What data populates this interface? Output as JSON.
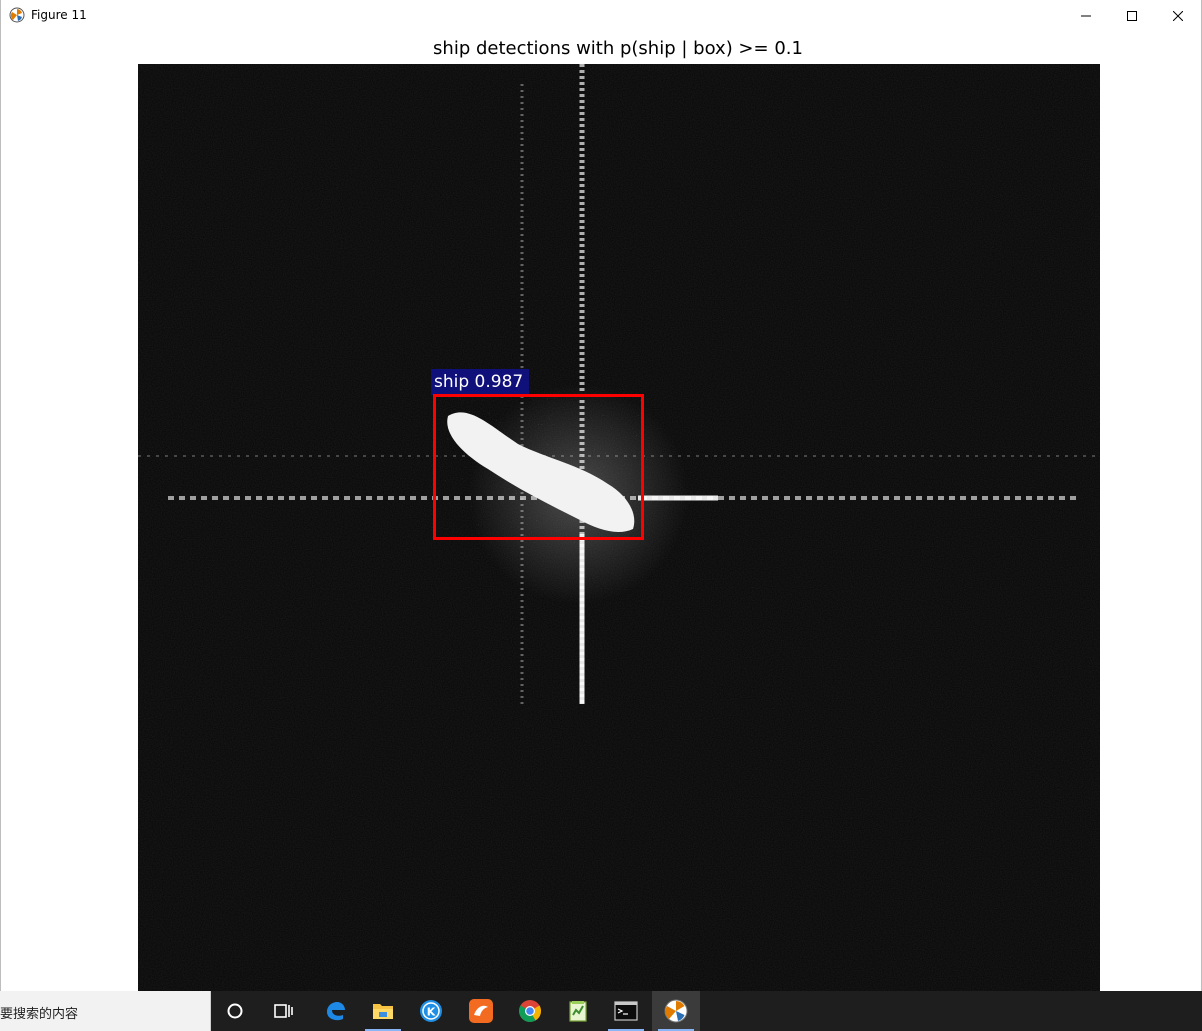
{
  "window": {
    "title": "Figure 11"
  },
  "figure": {
    "title": "ship detections with p(ship | box) >= 0.1",
    "detection": {
      "label": "ship 0.987",
      "box_color": "#ff0000",
      "label_bg": "#10107a"
    }
  },
  "taskbar": {
    "search_text": "要搜索的内容",
    "items": [
      {
        "name": "cortana-icon"
      },
      {
        "name": "task-view-icon"
      },
      {
        "name": "edge-browser-icon"
      },
      {
        "name": "file-explorer-icon"
      },
      {
        "name": "k-app-icon"
      },
      {
        "name": "orange-app-icon"
      },
      {
        "name": "chrome-browser-icon"
      },
      {
        "name": "notepad-plus-icon"
      },
      {
        "name": "terminal-icon"
      },
      {
        "name": "figure-window-icon"
      }
    ]
  }
}
